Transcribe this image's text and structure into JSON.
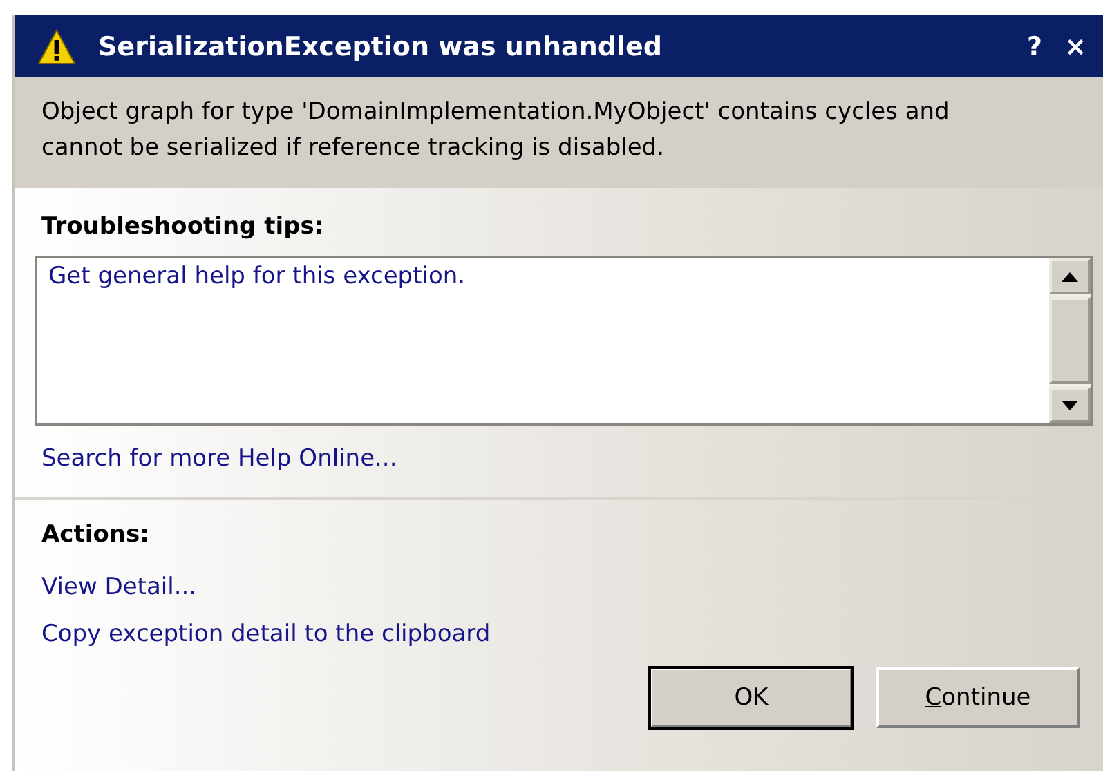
{
  "window": {
    "title": "SerializationException was unhandled",
    "controls": [
      "?",
      "×"
    ]
  },
  "message": "Object graph for type 'DomainImplementation.MyObject' contains cycles and cannot be serialized if reference tracking is disabled.",
  "troubleshooting": {
    "heading": "Troubleshooting tips:",
    "tips": [
      "Get general help for this exception."
    ],
    "search_link": "Search for more Help Online..."
  },
  "actions": {
    "heading": "Actions:",
    "links": [
      "View Detail...",
      "Copy exception detail to the clipboard"
    ]
  },
  "buttons": [
    {
      "label": "OK",
      "default": true,
      "mnemonic": false
    },
    {
      "label": "Continue",
      "default": false,
      "mnemonic": true
    }
  ]
}
